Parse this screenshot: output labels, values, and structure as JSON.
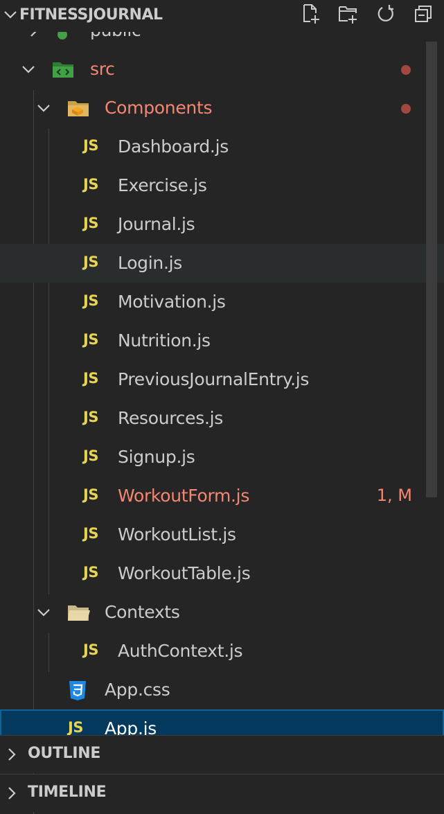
{
  "explorer": {
    "title": "FITNESSJOURNAL",
    "actions": [
      "new-file-icon",
      "new-folder-icon",
      "refresh-icon",
      "collapse-all-icon"
    ]
  },
  "tree": {
    "public": "public",
    "src": "src",
    "components": "Components",
    "files": [
      {
        "icon": "JS",
        "name": "Dashboard.js"
      },
      {
        "icon": "JS",
        "name": "Exercise.js"
      },
      {
        "icon": "JS",
        "name": "Journal.js"
      },
      {
        "icon": "JS",
        "name": "Login.js"
      },
      {
        "icon": "JS",
        "name": "Motivation.js"
      },
      {
        "icon": "JS",
        "name": "Nutrition.js"
      },
      {
        "icon": "JS",
        "name": "PreviousJournalEntry.js"
      },
      {
        "icon": "JS",
        "name": "Resources.js"
      },
      {
        "icon": "JS",
        "name": "Signup.js"
      },
      {
        "icon": "JS",
        "name": "WorkoutForm.js",
        "badge": "1, M"
      },
      {
        "icon": "JS",
        "name": "WorkoutList.js"
      },
      {
        "icon": "JS",
        "name": "WorkoutTable.js"
      }
    ],
    "contexts": "Contexts",
    "context_files": [
      {
        "icon": "JS",
        "name": "AuthContext.js"
      }
    ],
    "app_css": "App.css",
    "app_js": {
      "icon": "JS",
      "name": "App.js"
    }
  },
  "sections": {
    "outline": "OUTLINE",
    "timeline": "TIMELINE"
  },
  "colors": {
    "background": "#252526",
    "text": "#cccccc",
    "error": "#f48771",
    "js_icon": "#e8d44d",
    "selected": "#04395e",
    "modified_dot": "#a1493e"
  }
}
